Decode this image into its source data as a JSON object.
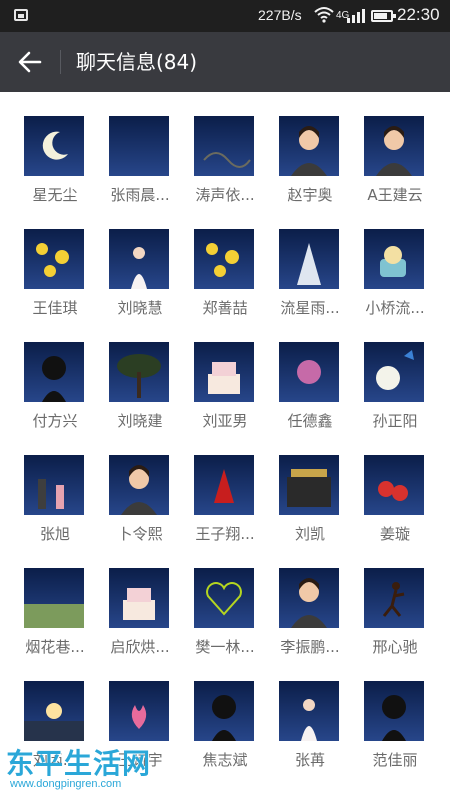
{
  "status_bar": {
    "speed": "227B/s",
    "network": "4G",
    "time": "22:30",
    "battery_level": 0.8
  },
  "header": {
    "back_icon": "arrow-left-icon",
    "title": "聊天信息(84)"
  },
  "members": [
    {
      "name": "星无尘",
      "colors": [
        "#0b1e49",
        "#27468a"
      ],
      "motif": "moon"
    },
    {
      "name": "张雨晨...",
      "colors": [
        "#07282a",
        "#1c4a48"
      ],
      "motif": "dark"
    },
    {
      "name": "涛声依...",
      "colors": [
        "#d9d4c6",
        "#9a9f96"
      ],
      "motif": "painting"
    },
    {
      "name": "赵宇奥",
      "colors": [
        "#f2ede6",
        "#c98f7e"
      ],
      "motif": "person"
    },
    {
      "name": "A王建云",
      "colors": [
        "#f1eadf",
        "#bfa585"
      ],
      "motif": "child"
    },
    {
      "name": "王佳琪",
      "colors": [
        "#7fb26a",
        "#e3c0a8"
      ],
      "motif": "flowers"
    },
    {
      "name": "刘晓慧",
      "colors": [
        "#c3a8df",
        "#8a6fbe"
      ],
      "motif": "lavender"
    },
    {
      "name": "郑善喆",
      "colors": [
        "#2d4b1c",
        "#f0c21d"
      ],
      "motif": "yellow-flowers"
    },
    {
      "name": "流星雨...",
      "colors": [
        "#0d2c6b",
        "#3c74c6"
      ],
      "motif": "stage"
    },
    {
      "name": "小桥流...",
      "colors": [
        "#9fcfdc",
        "#e8d8b0"
      ],
      "motif": "cup"
    },
    {
      "name": "付方兴",
      "colors": [
        "#cfe5b8",
        "#6f9a4a"
      ],
      "motif": "anime"
    },
    {
      "name": "刘晓建",
      "colors": [
        "#ffffff",
        "#2f3a28"
      ],
      "motif": "tree"
    },
    {
      "name": "刘亚男",
      "colors": [
        "#f3ede4",
        "#e7b3b4"
      ],
      "motif": "cakes"
    },
    {
      "name": "任德鑫",
      "colors": [
        "#3b1f48",
        "#9d4f8a"
      ],
      "motif": "purple"
    },
    {
      "name": "孙正阳",
      "colors": [
        "#2f6a3c",
        "#b8d6a5"
      ],
      "motif": "dandelion"
    },
    {
      "name": "张旭",
      "colors": [
        "#b8b4a8",
        "#4d6178"
      ],
      "motif": "family"
    },
    {
      "name": "卜令熙",
      "colors": [
        "#f5f1ee",
        "#2a2a2a"
      ],
      "motif": "boy"
    },
    {
      "name": "王子翔...",
      "colors": [
        "#f7f3ee",
        "#c71e1e"
      ],
      "motif": "dancer"
    },
    {
      "name": "刘凯",
      "colors": [
        "#141414",
        "#8c6b2f"
      ],
      "motif": "shop"
    },
    {
      "name": "姜璇",
      "colors": [
        "#3b6a2c",
        "#d8322e"
      ],
      "motif": "strawberry"
    },
    {
      "name": "烟花巷...",
      "colors": [
        "#6b8f4d",
        "#3f6b2c"
      ],
      "motif": "garden"
    },
    {
      "name": "启欣烘...",
      "colors": [
        "#101010",
        "#f4ede6"
      ],
      "motif": "cake"
    },
    {
      "name": "樊一林...",
      "colors": [
        "#050505",
        "#b5d620"
      ],
      "motif": "heart"
    },
    {
      "name": "李振鹏...",
      "colors": [
        "#f0d9cf",
        "#d46e85"
      ],
      "motif": "woman"
    },
    {
      "name": "邢心驰",
      "colors": [
        "#f3a74c",
        "#a35317"
      ],
      "motif": "runner"
    },
    {
      "name": "刘丙...",
      "colors": [
        "#f29b3b",
        "#26334b"
      ],
      "motif": "sunset"
    },
    {
      "name": "王诗宇",
      "colors": [
        "#1d1d1d",
        "#e76b9c"
      ],
      "motif": "lotus"
    },
    {
      "name": "焦志斌",
      "colors": [
        "#ffffff",
        "#111111"
      ],
      "motif": "anime-boy"
    },
    {
      "name": "张苒",
      "colors": [
        "#c3a8df",
        "#9a7fca"
      ],
      "motif": "lavender"
    },
    {
      "name": "范佳丽",
      "colors": [
        "#f2f2f2",
        "#111111"
      ],
      "motif": "girl"
    }
  ],
  "watermark": {
    "text": "东平生活网",
    "url": "www.dongpingren.com"
  }
}
